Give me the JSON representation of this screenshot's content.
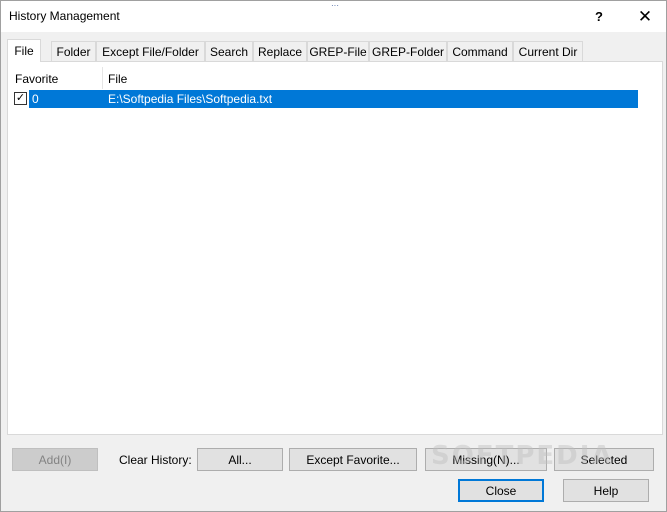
{
  "window": {
    "title": "History Management",
    "help_symbol": "?",
    "close_symbol": "✕"
  },
  "tabs": [
    {
      "label": "File",
      "active": true
    },
    {
      "label": "Folder"
    },
    {
      "label": "Except File/Folder"
    },
    {
      "label": "Search"
    },
    {
      "label": "Replace"
    },
    {
      "label": "GREP-File"
    },
    {
      "label": "GREP-Folder"
    },
    {
      "label": "Command"
    },
    {
      "label": "Current Dir"
    }
  ],
  "list": {
    "columns": [
      "Favorite",
      "File"
    ],
    "rows": [
      {
        "checked": true,
        "favorite": "0",
        "file": "E:\\Softpedia Files\\Softpedia.txt",
        "selected": true
      }
    ]
  },
  "actions": {
    "add_label": "Add(I)",
    "clear_history_label": "Clear History:",
    "all_label": "All...",
    "except_favorite_label": "Except Favorite...",
    "missing_label": "Missing(N)...",
    "selected_label": "Selected",
    "close_label": "Close",
    "help_label": "Help"
  },
  "watermark": "SOFTPEDIA",
  "colors": {
    "selection": "#0078d7",
    "default_button_border": "#0078d7"
  }
}
